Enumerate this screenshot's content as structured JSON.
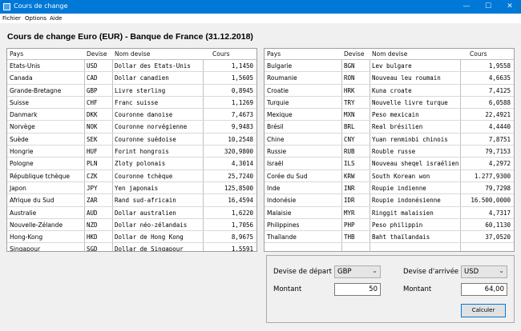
{
  "window": {
    "title": "Cours de change",
    "minimize_glyph": "—",
    "maximize_glyph": "☐",
    "close_glyph": "✕"
  },
  "menu": [
    "Fichier",
    "Options",
    "Aide"
  ],
  "heading": "Cours de change Euro (EUR) - Banque de France (31.12.2018)",
  "columns": {
    "pays": "Pays",
    "devise": "Devise",
    "nom": "Nom devise",
    "cours": "Cours"
  },
  "left_table": [
    [
      "Etats-Unis",
      "USD",
      "Dollar des Etats-Unis",
      "1,1450"
    ],
    [
      "Canada",
      "CAD",
      "Dollar canadien",
      "1,5605"
    ],
    [
      "Grande-Bretagne",
      "GBP",
      "Livre sterling",
      "0,8945"
    ],
    [
      "Suisse",
      "CHF",
      "Franc suisse",
      "1,1269"
    ],
    [
      "Danmark",
      "DKK",
      "Couronne danoise",
      "7,4673"
    ],
    [
      "Norvège",
      "NOK",
      "Couronne norvégienne",
      "9,9483"
    ],
    [
      "Suède",
      "SEK",
      "Couronne suédoise",
      "10,2548"
    ],
    [
      "Hongrie",
      "HUF",
      "Forint hongrois",
      "320,9800"
    ],
    [
      "Pologne",
      "PLN",
      "Zloty polonais",
      "4,3014"
    ],
    [
      "République tchèque",
      "CZK",
      "Couronne tchèque",
      "25,7240"
    ],
    [
      "Japon",
      "JPY",
      "Yen japonais",
      "125,8500"
    ],
    [
      "Afrique du Sud",
      "ZAR",
      "Rand sud-africain",
      "16,4594"
    ],
    [
      "Australie",
      "AUD",
      "Dollar australien",
      "1,6220"
    ],
    [
      "Nouvelle-Zélande",
      "NZD",
      "Dollar néo-zélandais",
      "1,7056"
    ],
    [
      "Hong-Kong",
      "HKD",
      "Dollar de Hong Kong",
      "8,9675"
    ],
    [
      "Singapour",
      "SGD",
      "Dollar de Singapour",
      "1,5591"
    ]
  ],
  "right_table": [
    [
      "Bulgarie",
      "BGN",
      "Lev bulgare",
      "1,9558"
    ],
    [
      "Roumanie",
      "RON",
      "Nouveau leu roumain",
      "4,6635"
    ],
    [
      "Croatie",
      "HRK",
      "Kuna croate",
      "7,4125"
    ],
    [
      "Turquie",
      "TRY",
      "Nouvelle livre turque",
      "6,0588"
    ],
    [
      "Mexique",
      "MXN",
      "Peso mexicain",
      "22,4921"
    ],
    [
      "Brésil",
      "BRL",
      "Real brésilien",
      "4,4440"
    ],
    [
      "Chine",
      "CNY",
      "Yuan renminbi chinois",
      "7,8751"
    ],
    [
      "Russie",
      "RUB",
      "Rouble russe",
      "79,7153"
    ],
    [
      "Israël",
      "ILS",
      "Nouveau sheqel israélien",
      "4,2972"
    ],
    [
      "Corée du Sud",
      "KRW",
      "South Korean won",
      "1.277,9300"
    ],
    [
      "Inde",
      "INR",
      "Roupie indienne",
      "79,7298"
    ],
    [
      "Indonésie",
      "IDR",
      "Roupie indonésienne",
      "16.500,0000"
    ],
    [
      "Malaisie",
      "MYR",
      "Ringgit malaisien",
      "4,7317"
    ],
    [
      "Philippines",
      "PHP",
      "Peso philippin",
      "60,1130"
    ],
    [
      "Thaïlande",
      "THB",
      "Baht thaïlandais",
      "37,0520"
    ],
    [
      "",
      "",
      "",
      ""
    ]
  ],
  "converter": {
    "from_label": "Devise de départ",
    "from_value": "GBP",
    "to_label": "Devise d'arrivée",
    "to_value": "USD",
    "amount_label": "Montant",
    "amount_in": "50",
    "result_label": "Montant",
    "amount_out": "64,00",
    "calc_button": "Calculer"
  }
}
